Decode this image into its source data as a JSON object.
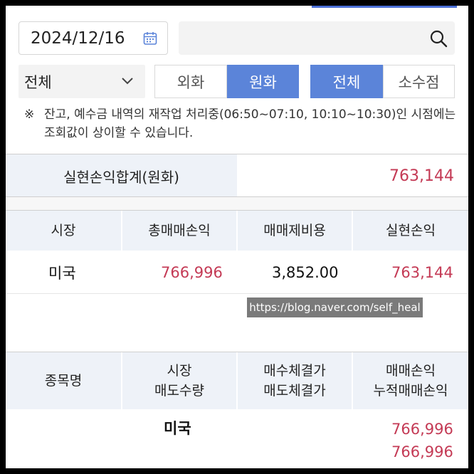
{
  "search": {
    "date": "2024/12/16",
    "query": ""
  },
  "filters": {
    "market_select": "전체",
    "currency_tabs": [
      {
        "label": "외화",
        "selected": false
      },
      {
        "label": "원화",
        "selected": true
      }
    ],
    "unit_tabs": [
      {
        "label": "전체",
        "selected": true
      },
      {
        "label": "소수점",
        "selected": false
      }
    ]
  },
  "notice": {
    "mark": "※",
    "text": "잔고, 예수금 내역의 재작업 처리중(06:50~07:10, 10:10~10:30)인 시점에는 조회값이 상이할 수 있습니다."
  },
  "summary": {
    "label": "실현손익합계(원화)",
    "value": "763,144"
  },
  "market_table": {
    "headers": [
      "시장",
      "총매매손익",
      "매매제비용",
      "실현손익"
    ],
    "rows": [
      {
        "market": "미국",
        "total_pnl": "766,996",
        "cost": "3,852.00",
        "realized": "763,144"
      }
    ]
  },
  "watermark": "https://blog.naver.com/self_heal",
  "detail_table": {
    "headers": [
      {
        "line1": "종목명",
        "line2": ""
      },
      {
        "line1": "시장",
        "line2": "매도수량"
      },
      {
        "line1": "매수체결가",
        "line2": "매도체결가"
      },
      {
        "line1": "매매손익",
        "line2": "누적매매손익"
      }
    ],
    "rows": [
      {
        "market": "미국",
        "pnl": "766,996",
        "cum_pnl": "766,996"
      }
    ]
  },
  "colors": {
    "accent": "#5b84d9",
    "profit": "#c43a55",
    "header_bg": "#eef2f8"
  }
}
